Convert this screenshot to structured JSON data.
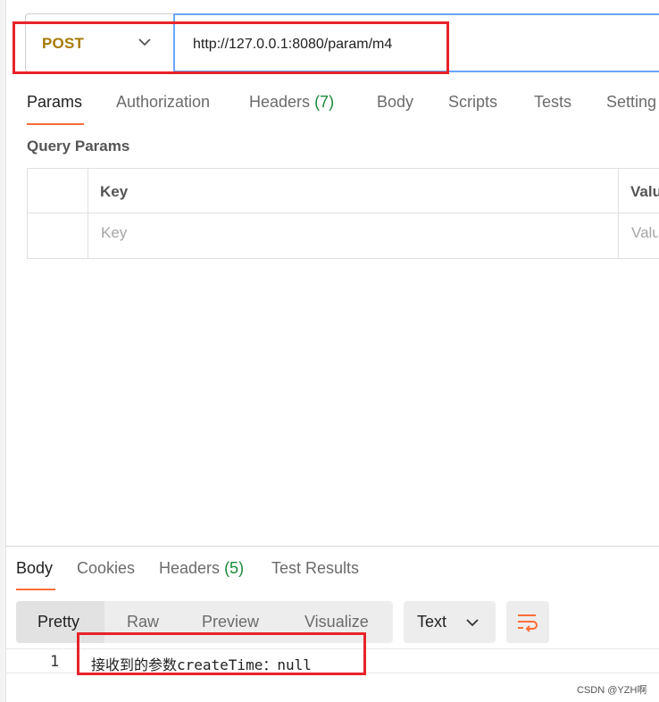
{
  "request": {
    "method": "POST",
    "url": "http://127.0.0.1:8080/param/m4"
  },
  "request_tabs": [
    {
      "label": "Params",
      "active": true
    },
    {
      "label": "Authorization"
    },
    {
      "label": "Headers",
      "count": "(7)"
    },
    {
      "label": "Body"
    },
    {
      "label": "Scripts"
    },
    {
      "label": "Tests"
    },
    {
      "label": "Setting"
    }
  ],
  "query_params": {
    "title": "Query Params",
    "columns": [
      "Key",
      "Valu"
    ],
    "placeholders": {
      "key": "Key",
      "value": "Valu"
    }
  },
  "response_tabs": [
    {
      "label": "Body",
      "active": true
    },
    {
      "label": "Cookies"
    },
    {
      "label": "Headers",
      "count": "(5)"
    },
    {
      "label": "Test Results"
    }
  ],
  "view_modes": [
    "Pretty",
    "Raw",
    "Preview",
    "Visualize"
  ],
  "active_view_mode": "Pretty",
  "format": "Text",
  "response_body": {
    "line_number": "1",
    "content": "接收到的参数createTime：null"
  },
  "watermark": "CSDN @YZH啊",
  "colors": {
    "method": "#a67a00",
    "accent": "#ff6c37",
    "highlight_box": "#e8232a",
    "url_focus": "#6aa6ff",
    "count": "#1a8a3a"
  }
}
